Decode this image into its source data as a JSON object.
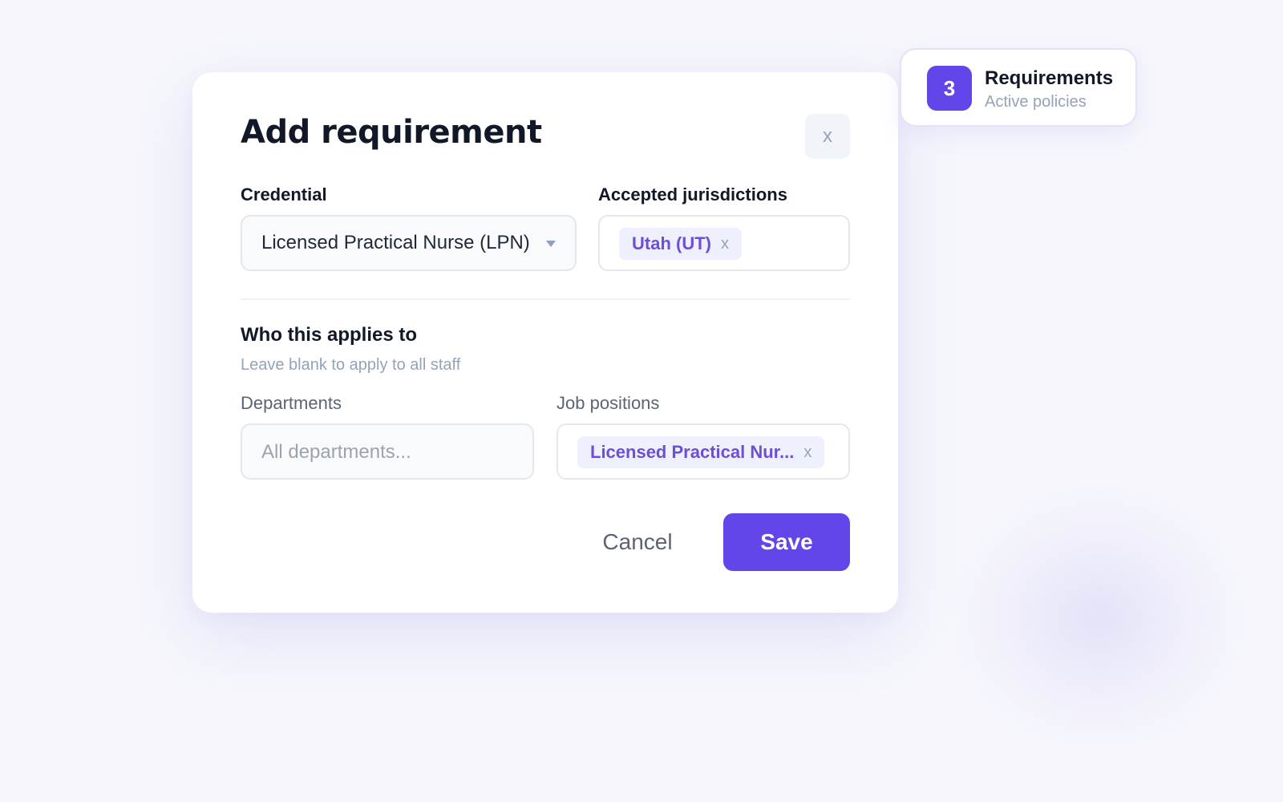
{
  "modal": {
    "title": "Add requirement",
    "close_label": "x",
    "credential": {
      "label": "Credential",
      "value": "Licensed Practical Nurse (LPN)"
    },
    "jurisdictions": {
      "label": "Accepted jurisdictions",
      "chips": [
        {
          "label": "Utah (UT)",
          "remove": "x"
        }
      ]
    },
    "applies": {
      "title": "Who this applies to",
      "hint": "Leave blank to apply to all staff",
      "departments": {
        "label": "Departments",
        "placeholder": "All departments..."
      },
      "job_positions": {
        "label": "Job positions",
        "chips": [
          {
            "label": "Licensed Practical Nur...",
            "remove": "x"
          }
        ]
      }
    },
    "actions": {
      "cancel": "Cancel",
      "save": "Save"
    }
  },
  "requirements_card": {
    "count": "3",
    "title": "Requirements",
    "subtitle": "Active policies"
  },
  "colors": {
    "accent": "#6246ea",
    "chip_text": "#6d4fd6",
    "chip_bg": "#eef0fd",
    "background": "#f6f6fc"
  },
  "icons": {
    "close": "close-icon",
    "dropdown": "chevron-down-icon",
    "chip_remove": "remove-chip-icon"
  }
}
